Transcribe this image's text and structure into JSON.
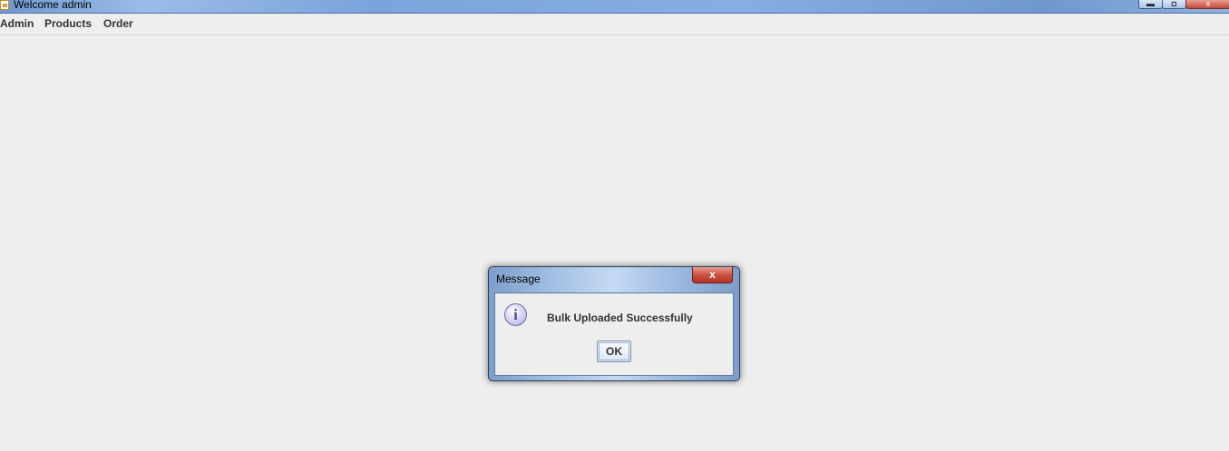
{
  "window": {
    "title": "Welcome admin",
    "controls": {
      "minimize": "▬",
      "maximize": "◘",
      "close": "x"
    }
  },
  "menubar": {
    "items": [
      {
        "label": "Admin"
      },
      {
        "label": "Products"
      },
      {
        "label": "Order"
      }
    ]
  },
  "dialog": {
    "title": "Message",
    "close_glyph": "x",
    "icon": "info-icon",
    "icon_glyph": "i",
    "message": "Bulk Uploaded Successfully",
    "ok_label": "OK"
  },
  "colors": {
    "background": "#eeeeee",
    "titlebar_accent": "#7aa4db",
    "close_red": "#c9503f"
  }
}
